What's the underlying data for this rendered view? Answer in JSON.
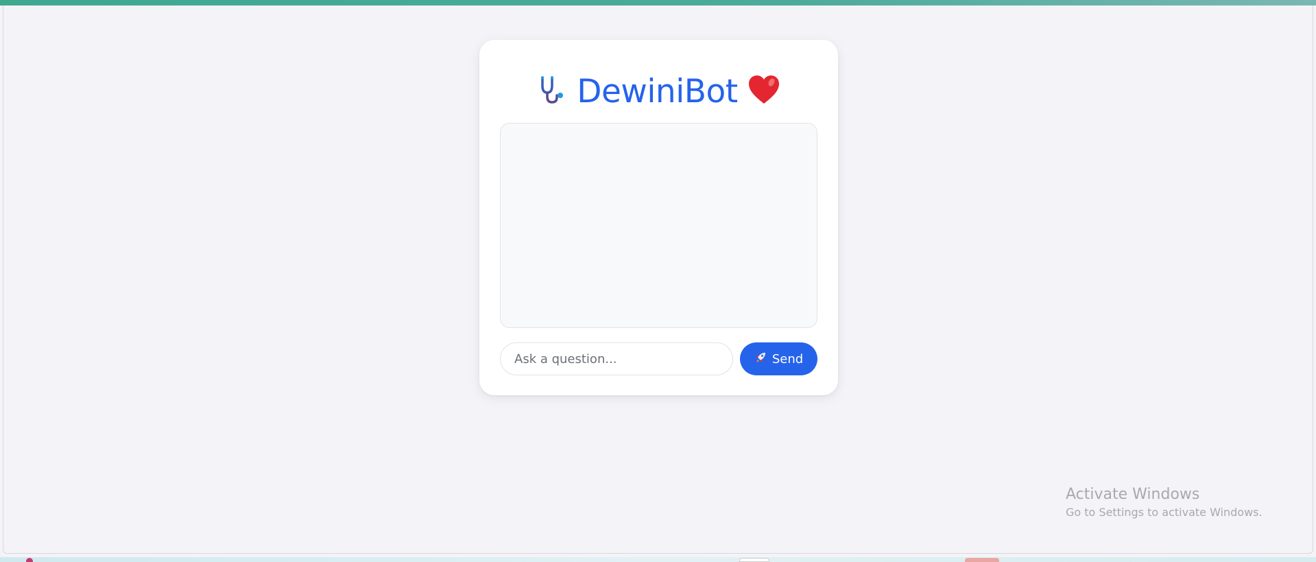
{
  "app": {
    "title": "DewiniBot",
    "title_icon_left": "stethoscope-icon",
    "title_icon_right": "red-heart-icon",
    "accent_color": "#2563eb"
  },
  "chat": {
    "messages": []
  },
  "composer": {
    "input_value": "",
    "input_placeholder": "Ask a question...",
    "send_label": "Send",
    "send_icon": "rocket-icon"
  },
  "watermark": {
    "title": "Activate Windows",
    "subtitle": "Go to Settings to activate Windows."
  }
}
